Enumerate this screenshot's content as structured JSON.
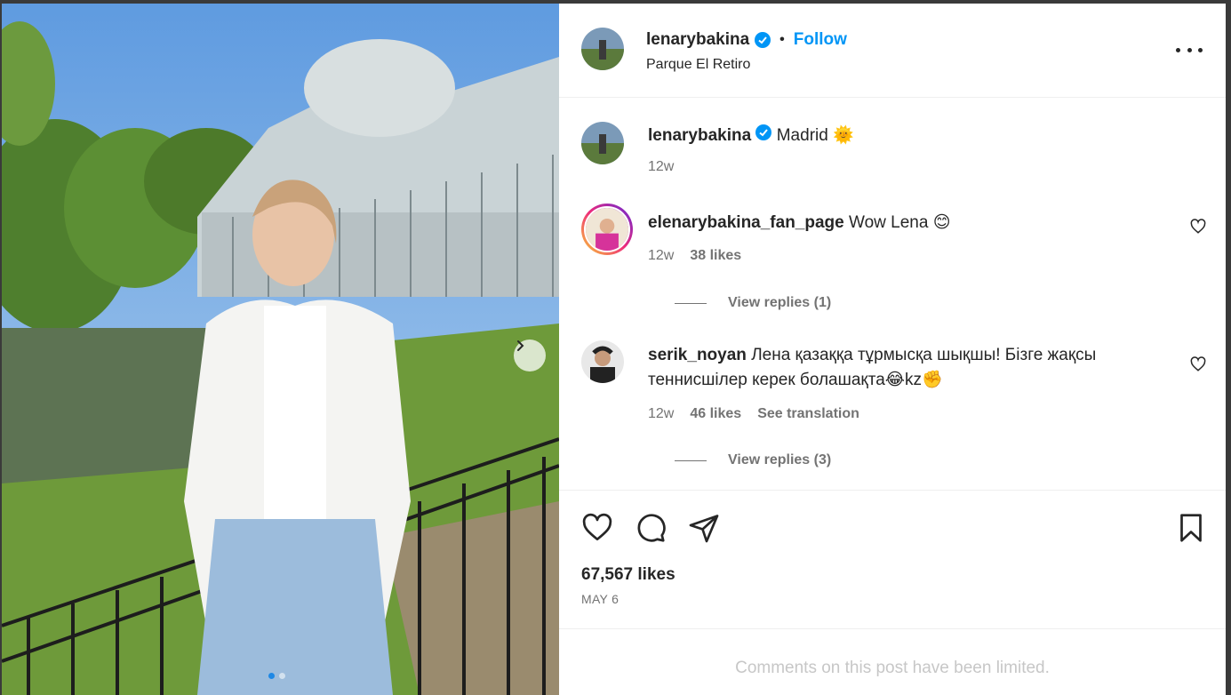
{
  "post": {
    "username": "lenarybakina",
    "separator": "•",
    "follow_label": "Follow",
    "location": "Parque El Retiro",
    "caption_text": "Madrid",
    "caption_emoji": "🌞",
    "caption_time": "12w",
    "likes": "67,567 likes",
    "date": "MAY 6",
    "comments_limited": "Comments on this post have been limited."
  },
  "comments": [
    {
      "username": "elenarybakina_fan_page",
      "text": "Wow Lena 😊",
      "time": "12w",
      "likes": "38 likes",
      "replies": "View replies (1)"
    },
    {
      "username": "serik_noyan",
      "text": "Лена қазаққа тұрмысқа шықшы! Бізге жақсы теннисшілер керек болашақта😂kz✊",
      "time": "12w",
      "likes": "46 likes",
      "translation": "See translation",
      "replies": "View replies (3)"
    }
  ],
  "icons": {
    "verified": "verified-badge-icon",
    "more": "more-options-icon",
    "like": "heart-icon",
    "comment": "comment-bubble-icon",
    "share": "paper-plane-icon",
    "save": "bookmark-icon",
    "next": "chevron-right-icon"
  },
  "colors": {
    "accent": "#0095f6",
    "text": "#262626",
    "muted": "#737373",
    "verified": "#0095f6"
  },
  "carousel": {
    "count": 2,
    "active": 1
  }
}
